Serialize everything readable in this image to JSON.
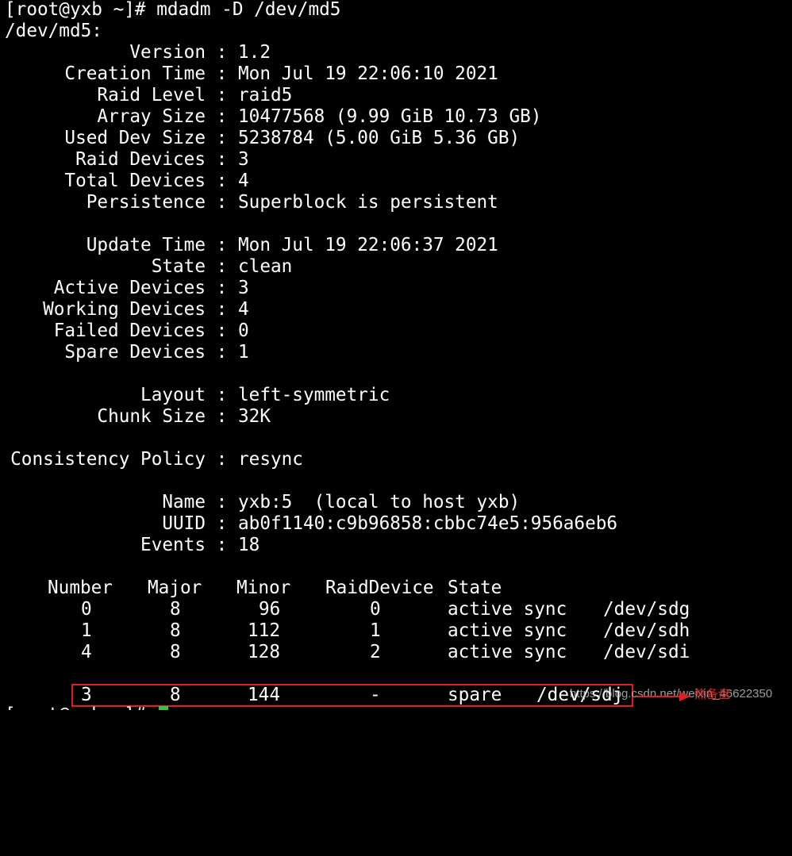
{
  "terminal": {
    "prompt": "[root@yxb ~]# mdadm -D /dev/md5",
    "device_header": "/dev/md5:",
    "fields": {
      "version": {
        "label": "Version",
        "value": "1.2"
      },
      "creation_time": {
        "label": "Creation Time",
        "value": "Mon Jul 19 22:06:10 2021"
      },
      "raid_level": {
        "label": "Raid Level",
        "value": "raid5"
      },
      "array_size": {
        "label": "Array Size",
        "value": "10477568 (9.99 GiB 10.73 GB)"
      },
      "used_dev_size": {
        "label": "Used Dev Size",
        "value": "5238784 (5.00 GiB 5.36 GB)"
      },
      "raid_devices": {
        "label": "Raid Devices",
        "value": "3"
      },
      "total_devices": {
        "label": "Total Devices",
        "value": "4"
      },
      "persistence": {
        "label": "Persistence",
        "value": "Superblock is persistent"
      },
      "update_time": {
        "label": "Update Time",
        "value": "Mon Jul 19 22:06:37 2021"
      },
      "state": {
        "label": "State",
        "value": "clean"
      },
      "active_devices": {
        "label": "Active Devices",
        "value": "3"
      },
      "working_devices": {
        "label": "Working Devices",
        "value": "4"
      },
      "failed_devices": {
        "label": "Failed Devices",
        "value": "0"
      },
      "spare_devices": {
        "label": "Spare Devices",
        "value": "1"
      },
      "layout": {
        "label": "Layout",
        "value": "left-symmetric"
      },
      "chunk_size": {
        "label": "Chunk Size",
        "value": "32K"
      },
      "consistency_policy": {
        "label": "Consistency Policy",
        "value": "resync"
      },
      "name": {
        "label": "Name",
        "value": "yxb:5  (local to host yxb)"
      },
      "uuid": {
        "label": "UUID",
        "value": "ab0f1140:c9b96858:cbbc74e5:956a6eb6"
      },
      "events": {
        "label": "Events",
        "value": "18"
      }
    },
    "separator": " : ",
    "device_table": {
      "headers": {
        "number": "Number",
        "major": "Major",
        "minor": "Minor",
        "raid_device": "RaidDevice",
        "state": "State"
      },
      "rows": [
        {
          "number": "0",
          "major": "8",
          "minor": "96",
          "raid_device": "0",
          "state": "active sync",
          "device": "/dev/sdg"
        },
        {
          "number": "1",
          "major": "8",
          "minor": "112",
          "raid_device": "1",
          "state": "active sync",
          "device": "/dev/sdh"
        },
        {
          "number": "4",
          "major": "8",
          "minor": "128",
          "raid_device": "2",
          "state": "active sync",
          "device": "/dev/sdi"
        }
      ],
      "spare_row": {
        "number": "3",
        "major": "8",
        "minor": "144",
        "raid_device": "-",
        "state": "spare",
        "device": "/dev/sdj"
      }
    }
  },
  "annotation": {
    "label": "热备盘",
    "color": "#e02020"
  },
  "watermark": "https://blog.csdn.net/weixin_46622350",
  "colors": {
    "background": "#000000",
    "text": "#ffffff",
    "highlight": "#e02020",
    "cursor": "#3cc43c"
  }
}
